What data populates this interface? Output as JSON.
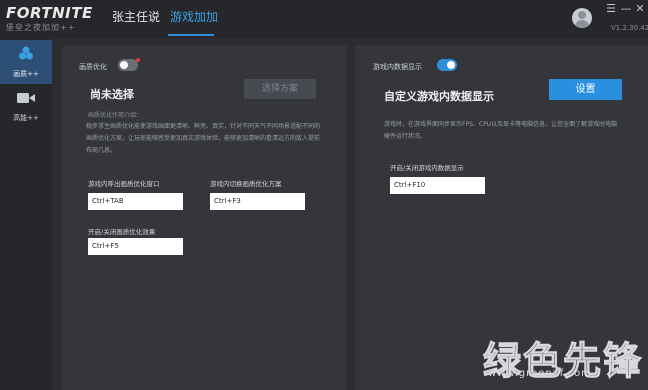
{
  "app": {
    "logo_title": "FORTNITE",
    "logo_subtitle": "堡垒之夜加加++",
    "version": "V1.2.30.42"
  },
  "nav": {
    "tabs": [
      {
        "label": "张主任说",
        "active": false
      },
      {
        "label": "游戏加加",
        "active": true
      }
    ]
  },
  "window_controls": {
    "menu": "☰",
    "minimize": "—",
    "close": "✕"
  },
  "sidebar": {
    "items": [
      {
        "label": "画质++",
        "icon": "palette-icon",
        "active": true
      },
      {
        "label": "高能++",
        "icon": "video-camera-icon",
        "active": false
      }
    ]
  },
  "left_panel": {
    "toggle_label": "画质优化",
    "toggle_on": false,
    "heading": "尚未选择",
    "select_button": "选择方案",
    "intro_title": "画质优化作用介绍：",
    "intro_text": "   稳步求生画质优化能使游戏画面更清晰、鲜亮、真实，针对不同天气不同场景适配不同的画质优化方案，让玩家能够感受更加真实游戏体验，能够更加清晰的看清远方的敌人提前布局几息。",
    "fields": [
      {
        "label": "游戏内呼出画质优化窗口",
        "value": "Ctrl+TAB"
      },
      {
        "label": "游戏内切换画质优化方案",
        "value": "Ctrl+F3"
      },
      {
        "label": "开启/关闭画质优化效果",
        "value": "Ctrl+F5"
      }
    ]
  },
  "right_panel": {
    "toggle_label": "游戏内数据显示",
    "toggle_on": true,
    "heading": "自定义游戏内数据显示",
    "settings_button": "设置",
    "info_text": "   游戏时，在游戏界面同步显示FPS、CPU以及显卡等电脑信息，让您全面了解游戏时电脑硬件运行状况。",
    "field": {
      "label": "开启/关闭游戏内数据显示",
      "value": "Ctrl+F10"
    }
  },
  "watermark": {
    "text": "绿色先锋",
    "url": "www.greenxf.com"
  },
  "colors": {
    "accent": "#2f8fd8",
    "background": "#2b2d31",
    "panel": "#34363b"
  }
}
